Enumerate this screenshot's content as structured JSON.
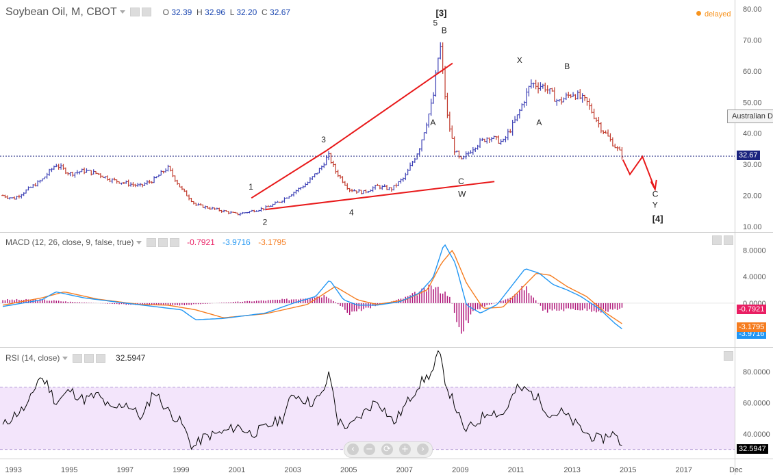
{
  "header": {
    "symbol": "Soybean Oil, M, CBOT",
    "ohlc": {
      "o_label": "O",
      "o": "32.39",
      "h_label": "H",
      "h": "32.96",
      "l_label": "L",
      "l": "32.20",
      "c_label": "C",
      "c": "32.67"
    },
    "delayed": "delayed",
    "delayed_color": "#f7931e"
  },
  "tooltip": {
    "text": "Australian D"
  },
  "macd_header": {
    "title": "MACD (12, 26, close, 9, false, true)",
    "hist": "-0.7921",
    "macd": "-3.9716",
    "signal": "-3.1795"
  },
  "rsi_header": {
    "title": "RSI (14, close)",
    "value": "32.5947"
  },
  "price_tags": {
    "last": "32.67",
    "macd_hist": "-0.7921",
    "macd_signal": "-3.1795",
    "macd_line": "-3.9716",
    "rsi": "32.5947"
  },
  "colors": {
    "up_bar": "#3b3fb5",
    "down_bar": "#c0392b",
    "wave_line": "#e8191a",
    "macd_line": "#2196f3",
    "signal_line": "#f57c1f",
    "hist": "#b0177a",
    "rsi_line": "#000000",
    "rsi_band": "#f3e5fb",
    "last_tag": "#1a237e",
    "macd_hist_tag": "#e91e63",
    "macd_line_tag": "#2196f3",
    "signal_tag": "#f57c1f",
    "rsi_tag": "#000000"
  },
  "icons": [
    "eye-icon",
    "gear-icon",
    "close-icon",
    "zoom-back-icon",
    "zoom-out-icon",
    "reset-icon",
    "zoom-in-icon",
    "zoom-forward-icon",
    "maximize-icon",
    "minimize-icon"
  ],
  "zoom_controls": {
    "back": "‹",
    "out": "−",
    "reset": "⟳",
    "in": "+",
    "forward": "›"
  },
  "chart_data": [
    {
      "type": "ohlc",
      "title": "Soybean Oil, M, CBOT",
      "x_ticks": [
        "1993",
        "1995",
        "1997",
        "1999",
        "2001",
        "2003",
        "2005",
        "2007",
        "2009",
        "2011",
        "2013",
        "2015",
        "2017",
        "Dec"
      ],
      "x_range": [
        1992.5,
        2018.8
      ],
      "y_ticks": [
        "10.00",
        "20.00",
        "30.00",
        "40.00",
        "50.00",
        "60.00",
        "70.00",
        "80.00"
      ],
      "ylim": [
        8.5,
        81.5
      ],
      "last_value": 32.67,
      "series": [
        {
          "x": [
            1992.6,
            1993.0,
            1993.5,
            1994.0,
            1994.5,
            1995.0,
            1995.5,
            1996.0,
            1996.5,
            1997.0,
            1997.5,
            1998.0,
            1998.5,
            1999.0,
            1999.5,
            2000.0,
            2000.5,
            2001.0,
            2001.5,
            2002.0,
            2002.5,
            2003.0,
            2003.5,
            2004.0,
            2004.25,
            2004.5,
            2005.0,
            2005.5,
            2006.0,
            2006.5,
            2007.0,
            2007.5,
            2008.0,
            2008.25,
            2008.5,
            2008.75,
            2009.0,
            2009.5,
            2010.0,
            2010.5,
            2011.0,
            2011.5,
            2012.0,
            2012.5,
            2013.0,
            2013.5,
            2014.0,
            2014.5,
            2014.8
          ],
          "close": [
            20,
            19,
            22,
            25,
            30,
            27,
            28,
            27,
            25,
            24,
            23,
            25,
            29,
            22,
            17,
            16,
            15,
            14,
            15,
            16,
            18,
            21,
            24,
            29,
            33,
            28,
            22,
            21,
            23,
            22,
            26,
            35,
            51,
            69,
            46,
            35,
            31,
            36,
            39,
            37,
            45,
            56,
            55,
            50,
            53,
            50,
            42,
            36,
            32.7
          ]
        }
      ],
      "annotations": [
        {
          "label": "1",
          "x": 2001.5,
          "y": 22.8
        },
        {
          "label": "2",
          "x": 2002.0,
          "y": 11.5
        },
        {
          "label": "3",
          "x": 2004.1,
          "y": 38
        },
        {
          "label": "4",
          "x": 2005.1,
          "y": 14.5
        },
        {
          "label": "[3]",
          "x": 2008.2,
          "y": 78.5
        },
        {
          "label": "5",
          "x": 2008.1,
          "y": 75.5
        },
        {
          "label": "B",
          "x": 2008.4,
          "y": 73
        },
        {
          "label": "A",
          "x": 2008.0,
          "y": 43.5
        },
        {
          "label": "C",
          "x": 2009.0,
          "y": 24.5
        },
        {
          "label": "W",
          "x": 2009.0,
          "y": 20.5
        },
        {
          "label": "X",
          "x": 2011.1,
          "y": 63.5
        },
        {
          "label": "A",
          "x": 2011.8,
          "y": 43.5
        },
        {
          "label": "B",
          "x": 2012.8,
          "y": 61.5
        },
        {
          "label": "C",
          "x": 2015.95,
          "y": 20.5
        },
        {
          "label": "Y",
          "x": 2015.95,
          "y": 17.0
        },
        {
          "label": "[4]",
          "x": 2015.95,
          "y": 12.5
        }
      ]
    },
    {
      "type": "line",
      "title": "MACD (12, 26, close, 9, false, true)",
      "y_ticks": [
        "8.0000",
        "4.0000",
        "0.0000"
      ],
      "ylim": [
        -6.5,
        10.5
      ],
      "series": [
        {
          "name": "MACD",
          "x": [
            1992.6,
            1994.0,
            1994.5,
            1995.5,
            1997.0,
            1998.0,
            1999.0,
            1999.5,
            2000.5,
            2002.0,
            2003.0,
            2003.8,
            2004.3,
            2004.8,
            2005.3,
            2006.0,
            2006.8,
            2007.5,
            2008.0,
            2008.4,
            2008.8,
            2009.2,
            2009.7,
            2010.3,
            2010.8,
            2011.3,
            2011.8,
            2012.3,
            2012.8,
            2013.3,
            2014.0,
            2014.5,
            2014.8
          ],
          "values": [
            -0.5,
            0.5,
            1.7,
            0.8,
            0,
            -0.5,
            -1,
            -2.5,
            -2.3,
            -1.5,
            0,
            1.0,
            3.5,
            0.5,
            -0.3,
            -0.3,
            0.2,
            1.5,
            3.8,
            9.0,
            6.0,
            -0.3,
            -1.5,
            -0.2,
            2.5,
            5.2,
            4.5,
            2.8,
            2.0,
            1.0,
            -1.0,
            -3.0,
            -3.97
          ]
        },
        {
          "name": "Signal",
          "x": [
            1992.6,
            1994.0,
            1994.8,
            1996.0,
            1997.5,
            1998.5,
            1999.5,
            2000.5,
            2002.0,
            2003.5,
            2004.5,
            2005.3,
            2006.0,
            2007.0,
            2007.8,
            2008.3,
            2008.7,
            2009.2,
            2009.8,
            2010.5,
            2011.0,
            2011.7,
            2012.2,
            2012.8,
            2013.5,
            2014.2,
            2014.8
          ],
          "values": [
            -0.3,
            0.8,
            1.7,
            0.6,
            -0.2,
            -0.3,
            -1.0,
            -2.2,
            -1.6,
            -0.2,
            2.5,
            0.5,
            -0.2,
            0.5,
            2.0,
            6.0,
            8.0,
            3.0,
            -0.8,
            -0.6,
            1.5,
            4.5,
            4.2,
            2.5,
            1.0,
            -1.5,
            -3.18
          ]
        },
        {
          "name": "Histogram",
          "x": [
            1994.0,
            1995.0,
            1997.0,
            1999.0,
            2001.0,
            2003.0,
            2004.2,
            2005.0,
            2007.0,
            2008.0,
            2008.6,
            2009.0,
            2009.5,
            2010.5,
            2011.3,
            2012.0,
            2013.0,
            2014.0,
            2014.8
          ],
          "values": [
            0.5,
            0.2,
            -0.2,
            -0.3,
            0.2,
            0.6,
            1.2,
            -1.5,
            0.8,
            2.5,
            1.2,
            -4.8,
            -1.0,
            0.4,
            2.4,
            -1.3,
            -0.9,
            -1.2,
            -0.79
          ]
        }
      ]
    },
    {
      "type": "line",
      "title": "RSI (14, close)",
      "y_ticks": [
        "40.0000",
        "60.0000",
        "80.0000"
      ],
      "ylim": [
        25,
        95
      ],
      "band": [
        30,
        70
      ],
      "series": [
        {
          "name": "RSI",
          "x": [
            1992.6,
            1993.0,
            1993.5,
            1993.9,
            1994.2,
            1994.5,
            1995.0,
            1995.5,
            1996.0,
            1996.5,
            1997.0,
            1997.6,
            1998.0,
            1998.5,
            1999.0,
            1999.4,
            1999.8,
            2000.5,
            2001.0,
            2001.5,
            2002.0,
            2002.6,
            2003.0,
            2003.6,
            2004.0,
            2004.3,
            2004.6,
            2005.0,
            2005.6,
            2006.0,
            2006.6,
            2007.0,
            2007.5,
            2008.0,
            2008.2,
            2008.5,
            2008.8,
            2009.1,
            2009.5,
            2010.0,
            2010.5,
            2011.0,
            2011.4,
            2011.8,
            2012.2,
            2012.6,
            2013.0,
            2013.5,
            2014.0,
            2014.4,
            2014.8
          ],
          "values": [
            45,
            52,
            58,
            77,
            72,
            60,
            68,
            62,
            65,
            55,
            60,
            50,
            68,
            55,
            47,
            31,
            38,
            41,
            45,
            40,
            44,
            50,
            66,
            60,
            64,
            79,
            48,
            44,
            55,
            62,
            47,
            58,
            72,
            80,
            93,
            70,
            58,
            42,
            46,
            55,
            52,
            69,
            68,
            62,
            52,
            54,
            48,
            40,
            36,
            41,
            32.6
          ]
        }
      ]
    }
  ]
}
